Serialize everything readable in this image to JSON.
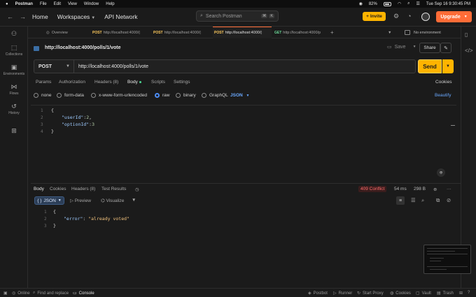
{
  "macbar": {
    "app_name": "Postman",
    "menus": [
      "File",
      "Edit",
      "View",
      "Window",
      "Help"
    ],
    "battery": "82%",
    "datetime": "Tue Sep 16  9:30:45 PM"
  },
  "header": {
    "home": "Home",
    "workspaces": "Workspaces",
    "api_network": "API Network",
    "search_placeholder": "Search Postman",
    "search_kbd": [
      "⌘",
      "K"
    ],
    "invite": "Invite",
    "upgrade": "Upgrade"
  },
  "sidebar": {
    "items": [
      {
        "label": "",
        "icon": "team-icon"
      },
      {
        "label": "Collections",
        "icon": "collections-icon"
      },
      {
        "label": "Environments",
        "icon": "environments-icon"
      },
      {
        "label": "Flows",
        "icon": "flows-icon"
      },
      {
        "label": "History",
        "icon": "history-icon"
      },
      {
        "label": "",
        "icon": "grid-icon"
      }
    ]
  },
  "tabs": {
    "items": [
      {
        "method": "",
        "label": "Overview"
      },
      {
        "method": "POST",
        "label": "http://localhost:4000/|"
      },
      {
        "method": "POST",
        "label": "http://localhost:4000/|"
      },
      {
        "method": "POST",
        "label": "http://localhost:4000/|"
      },
      {
        "method": "GET",
        "label": "http://localhost:4000/p"
      }
    ],
    "environment": "No environment"
  },
  "request": {
    "title": "http://localhost:4000/polls/1/vote",
    "save": "Save",
    "share": "Share",
    "method": "POST",
    "url": "http://localhost:4000/polls/1/vote",
    "send": "Send",
    "tabs": [
      "Params",
      "Authorization",
      "Headers (8)",
      "Body",
      "Scripts",
      "Settings"
    ],
    "cookies": "Cookies",
    "body_modes": [
      "none",
      "form-data",
      "x-www-form-urlencoded",
      "raw",
      "binary",
      "GraphQL"
    ],
    "body_type": "JSON",
    "beautify": "Beautify",
    "body_lines": [
      {
        "n": "1",
        "text": "{"
      },
      {
        "n": "2",
        "key": "\"userId\"",
        "sep": ":",
        "val": "2",
        "tail": ","
      },
      {
        "n": "3",
        "key": "\"optionId\"",
        "sep": ":",
        "val": "3",
        "tail": ""
      },
      {
        "n": "4",
        "text": "}"
      }
    ]
  },
  "response": {
    "tabs": [
      "Body",
      "Cookies",
      "Headers (8)",
      "Test Results"
    ],
    "status": "409 Conflict",
    "time": "54 ms",
    "size": "298 B",
    "format": "JSON",
    "preview": "Preview",
    "visualize": "Visualize",
    "body_lines": [
      {
        "n": "1",
        "text": "{"
      },
      {
        "n": "2",
        "key": "\"error\"",
        "sep": ": ",
        "val": "\"already voted\""
      },
      {
        "n": "3",
        "text": "}"
      }
    ]
  },
  "statusbar": {
    "online": "Online",
    "find_replace": "Find and replace",
    "console": "Console",
    "postbot": "Postbot",
    "runner": "Runner",
    "start_proxy": "Start Proxy",
    "cookies": "Cookies",
    "vault": "Vault",
    "trash": "Trash"
  }
}
